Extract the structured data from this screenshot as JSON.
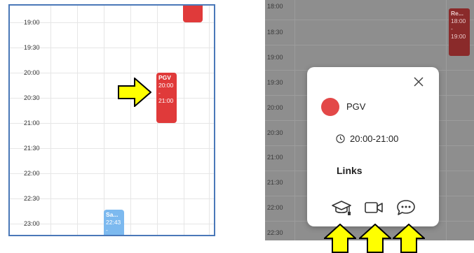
{
  "left": {
    "times": [
      "19:00",
      "19:30",
      "20:00",
      "20:30",
      "21:00",
      "21:30",
      "22:00",
      "22:30",
      "23:00"
    ],
    "event_main": {
      "title": "PGV",
      "start": "20:00",
      "dash": "-",
      "end": "21:00",
      "color": "#e03a3a"
    },
    "event_bottom": {
      "title": "Sa...",
      "time": "22:43",
      "dash": "-",
      "color": "#7cb9ef"
    },
    "event_top_color": "#e03a3a"
  },
  "right": {
    "times": [
      "18:00",
      "18:30",
      "19:00",
      "19:30",
      "20:00",
      "20:30",
      "21:00",
      "21:30",
      "22:00",
      "22:30"
    ],
    "bg_event": {
      "title": "Re...",
      "start": "18:00",
      "dash": "-",
      "end": "19:00"
    },
    "dialog": {
      "title": "PGV",
      "dot_color": "#e34848",
      "time": "20:00-21:00",
      "links_heading": "Links",
      "icons": [
        "graduation-cap-icon",
        "video-camera-icon",
        "chat-bubble-icon"
      ]
    }
  },
  "arrow_color": "#ffff00"
}
